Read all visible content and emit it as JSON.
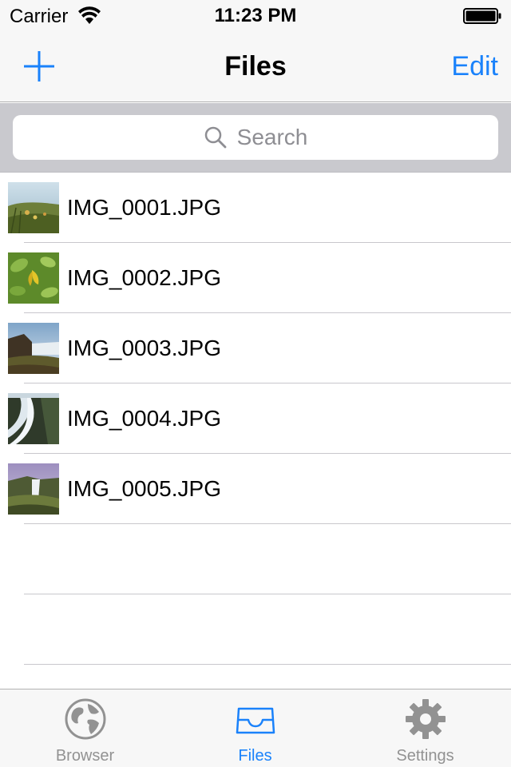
{
  "status_bar": {
    "carrier": "Carrier",
    "time": "11:23 PM"
  },
  "nav_bar": {
    "title": "Files",
    "edit_label": "Edit",
    "add_icon": "plus-icon"
  },
  "search": {
    "placeholder": "Search",
    "icon": "search-icon"
  },
  "files": [
    {
      "name": "IMG_0001.JPG"
    },
    {
      "name": "IMG_0002.JPG"
    },
    {
      "name": "IMG_0003.JPG"
    },
    {
      "name": "IMG_0004.JPG"
    },
    {
      "name": "IMG_0005.JPG"
    }
  ],
  "tab_bar": {
    "tabs": [
      {
        "label": "Browser",
        "icon": "globe-icon",
        "active": false
      },
      {
        "label": "Files",
        "icon": "inbox-tray-icon",
        "active": true
      },
      {
        "label": "Settings",
        "icon": "gear-icon",
        "active": false
      }
    ]
  },
  "colors": {
    "accent": "#1a82fb",
    "inactive_tab": "#929292",
    "separator": "#c8c7cc"
  }
}
